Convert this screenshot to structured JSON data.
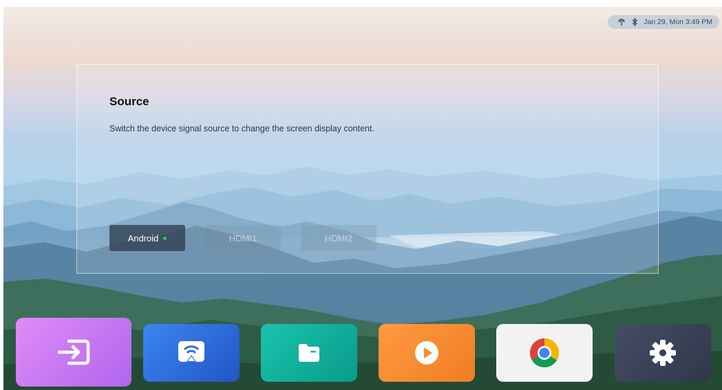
{
  "status_bar": {
    "datetime": "Jan 29, Mon  3:49 PM",
    "icons": [
      "wifi-hotspot-icon",
      "bluetooth-icon"
    ]
  },
  "source_panel": {
    "title": "Source",
    "description": "Switch the device signal source to change the screen display content.",
    "sources": [
      {
        "label": "Android",
        "active": true,
        "indicator_color": "#2ecc40"
      },
      {
        "label": "HDMI1",
        "active": false
      },
      {
        "label": "HDMI2",
        "active": false
      }
    ]
  },
  "dock": {
    "apps": [
      {
        "icon": "input-source-icon",
        "color": "#c374f2"
      },
      {
        "icon": "screen-cast-icon",
        "color": "#2f6fe0"
      },
      {
        "icon": "file-manager-icon",
        "color": "#10b3a0"
      },
      {
        "icon": "media-player-icon",
        "color": "#f58d35"
      },
      {
        "icon": "chrome-icon",
        "color": "#f2f2f2"
      },
      {
        "icon": "settings-icon",
        "color": "#3a4157"
      }
    ]
  }
}
